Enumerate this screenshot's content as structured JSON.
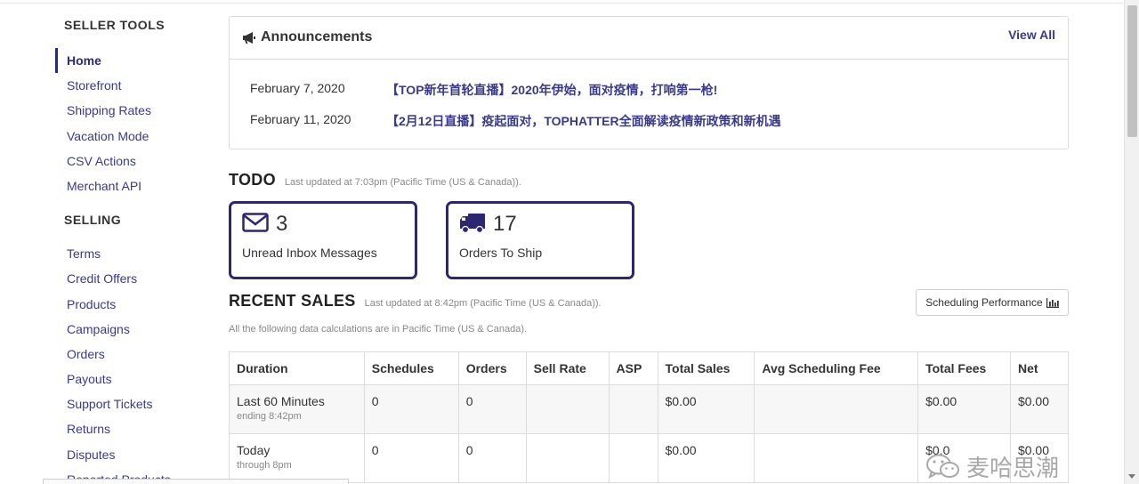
{
  "sidebar": {
    "seller_tools_heading": "SELLER TOOLS",
    "seller_tools": [
      {
        "label": "Home",
        "active": true
      },
      {
        "label": "Storefront"
      },
      {
        "label": "Shipping Rates"
      },
      {
        "label": "Vacation Mode"
      },
      {
        "label": "CSV Actions"
      },
      {
        "label": "Merchant API"
      }
    ],
    "selling_heading": "SELLING",
    "selling": [
      {
        "label": "Terms"
      },
      {
        "label": "Credit Offers"
      },
      {
        "label": "Products"
      },
      {
        "label": "Campaigns"
      },
      {
        "label": "Orders"
      },
      {
        "label": "Payouts"
      },
      {
        "label": "Support Tickets"
      },
      {
        "label": "Returns"
      },
      {
        "label": "Disputes"
      },
      {
        "label": "Reported Products"
      }
    ]
  },
  "announcements": {
    "title": "Announcements",
    "view_all": "View All",
    "icon": "megaphone-icon",
    "items": [
      {
        "date": "February 7, 2020",
        "text": "【TOP新年首轮直播】2020年伊始，面对疫情，打响第一枪!"
      },
      {
        "date": "February 11, 2020",
        "text": "【2月12日直播】疫起面对，TOPHATTER全面解读疫情新政策和新机遇"
      }
    ]
  },
  "todo": {
    "title": "TODO",
    "note": "Last updated at 7:03pm (Pacific Time (US & Canada)).",
    "cards": [
      {
        "icon": "envelope-icon",
        "count": "3",
        "label": "Unread Inbox Messages"
      },
      {
        "icon": "truck-icon",
        "count": "17",
        "label": "Orders To Ship"
      }
    ]
  },
  "recent_sales": {
    "title": "RECENT SALES",
    "note": "Last updated at 8:42pm (Pacific Time (US & Canada)).",
    "scheduling_button": "Scheduling Performance",
    "subnote": "All the following data calculations are in Pacific Time (US & Canada).",
    "columns": [
      "Duration",
      "Schedules",
      "Orders",
      "Sell Rate",
      "ASP",
      "Total Sales",
      "Avg Scheduling Fee",
      "Total Fees",
      "Net"
    ],
    "rows": [
      {
        "duration": "Last 60 Minutes",
        "sub": "ending 8:42pm",
        "schedules": "0",
        "orders": "0",
        "sell_rate": "",
        "asp": "",
        "total_sales": "$0.00",
        "avg_fee": "",
        "total_fees": "$0.00",
        "net": "$0.00"
      },
      {
        "duration": "Today",
        "sub": "through 8pm",
        "schedules": "0",
        "orders": "0",
        "sell_rate": "",
        "asp": "",
        "total_sales": "$0.00",
        "avg_fee": "",
        "total_fees": "$0.0",
        "net": "$0.00"
      }
    ]
  },
  "watermark": "麦哈思潮",
  "colors": {
    "accent": "#2d2670",
    "link": "#3a3a8c"
  }
}
